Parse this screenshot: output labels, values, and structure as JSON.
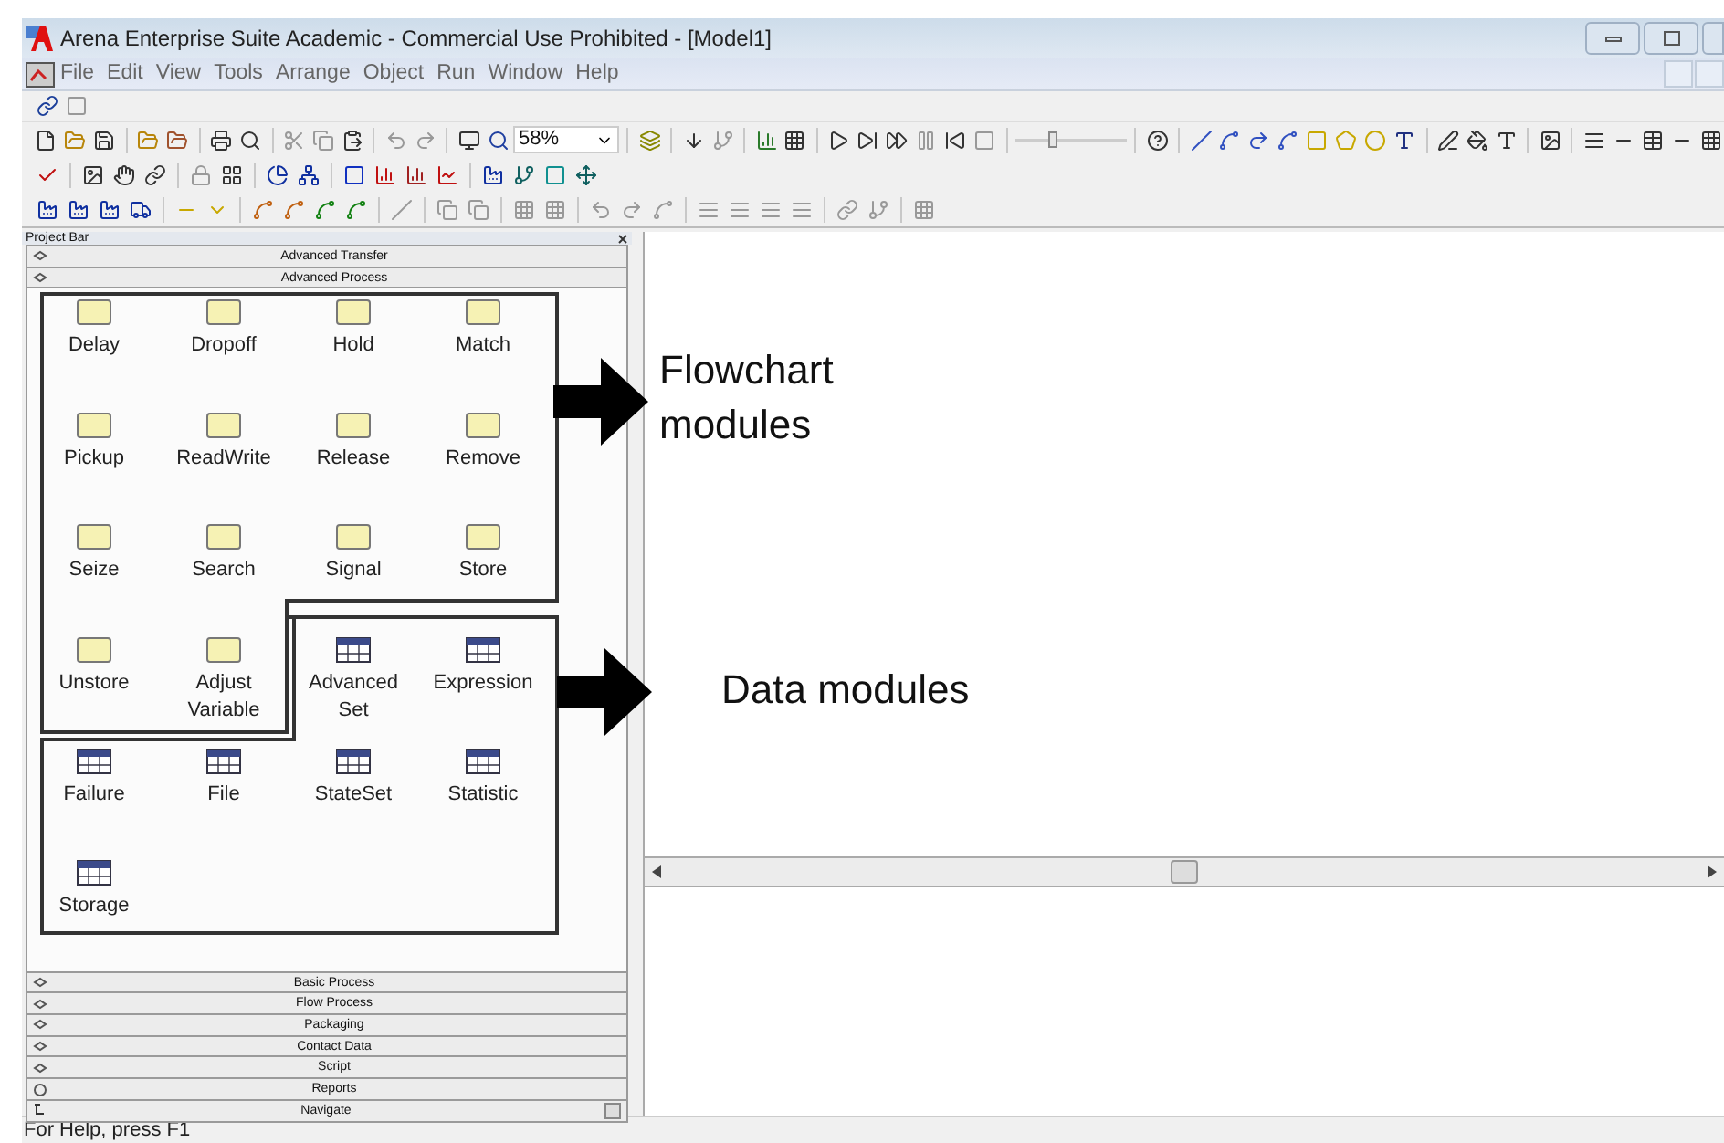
{
  "window": {
    "title": "Arena Enterprise Suite Academic - Commercial Use Prohibited - [Model1]"
  },
  "menu": [
    "File",
    "Edit",
    "View",
    "Tools",
    "Arrange",
    "Object",
    "Run",
    "Window",
    "Help"
  ],
  "toolbar": {
    "zoom": "58%",
    "speed_slider": {
      "level": 0.33
    }
  },
  "project_bar": {
    "title": "Project Bar",
    "panels_above": [
      {
        "label": "Advanced Transfer",
        "kind": "panel"
      },
      {
        "label": "Advanced Process",
        "kind": "panel"
      }
    ],
    "modules": [
      {
        "label": "Delay",
        "kind": "flowchart"
      },
      {
        "label": "Dropoff",
        "kind": "flowchart"
      },
      {
        "label": "Hold",
        "kind": "flowchart"
      },
      {
        "label": "Match",
        "kind": "flowchart"
      },
      {
        "label": "Pickup",
        "kind": "flowchart"
      },
      {
        "label": "ReadWrite",
        "kind": "flowchart"
      },
      {
        "label": "Release",
        "kind": "flowchart"
      },
      {
        "label": "Remove",
        "kind": "flowchart"
      },
      {
        "label": "Seize",
        "kind": "flowchart"
      },
      {
        "label": "Search",
        "kind": "flowchart"
      },
      {
        "label": "Signal",
        "kind": "flowchart"
      },
      {
        "label": "Store",
        "kind": "flowchart"
      },
      {
        "label": "Unstore",
        "kind": "flowchart"
      },
      {
        "label": "Adjust Variable",
        "kind": "flowchart"
      },
      {
        "label": "Advanced Set",
        "kind": "data"
      },
      {
        "label": "Expression",
        "kind": "data"
      },
      {
        "label": "Failure",
        "kind": "data"
      },
      {
        "label": "File",
        "kind": "data"
      },
      {
        "label": "StateSet",
        "kind": "data"
      },
      {
        "label": "Statistic",
        "kind": "data"
      },
      {
        "label": "Storage",
        "kind": "data"
      }
    ],
    "panels_below": [
      {
        "label": "Basic Process",
        "kind": "panel"
      },
      {
        "label": "Flow Process",
        "kind": "panel"
      },
      {
        "label": "Packaging",
        "kind": "panel"
      },
      {
        "label": "Contact Data",
        "kind": "panel"
      },
      {
        "label": "Script",
        "kind": "panel"
      },
      {
        "label": "Reports",
        "kind": "reports"
      },
      {
        "label": "Navigate",
        "kind": "navigate"
      }
    ]
  },
  "annotations": [
    {
      "text": "Flowchart modules",
      "kind": "flowchart"
    },
    {
      "text": "Data modules",
      "kind": "data"
    }
  ],
  "status_bar": {
    "text": "For Help, press F1"
  }
}
